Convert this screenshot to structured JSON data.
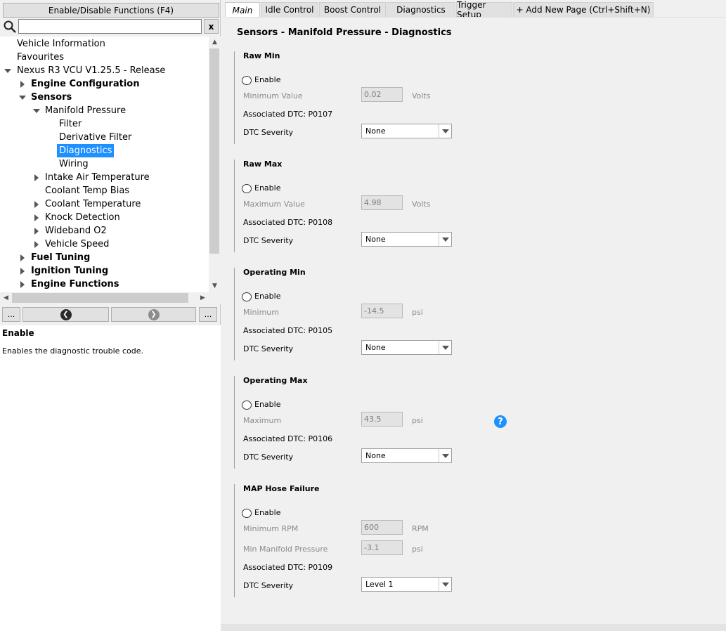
{
  "left": {
    "toggle_button": "Enable/Disable Functions (F4)",
    "search_value": "",
    "search_clear": "x",
    "tree": [
      {
        "label": "Vehicle Information",
        "bold": false,
        "level": 0,
        "arrow": "none",
        "selected": false
      },
      {
        "label": "Favourites",
        "bold": false,
        "level": 0,
        "arrow": "none",
        "selected": false
      },
      {
        "label": "Nexus R3 VCU V1.25.5 - Release",
        "bold": false,
        "level": 0,
        "arrow": "down",
        "selected": false
      },
      {
        "label": "Engine Configuration",
        "bold": true,
        "level": 1,
        "arrow": "right",
        "selected": false
      },
      {
        "label": "Sensors",
        "bold": true,
        "level": 1,
        "arrow": "down",
        "selected": false
      },
      {
        "label": "Manifold Pressure",
        "bold": false,
        "level": 2,
        "arrow": "down",
        "selected": false
      },
      {
        "label": "Filter",
        "bold": false,
        "level": 3,
        "arrow": "none",
        "selected": false
      },
      {
        "label": "Derivative Filter",
        "bold": false,
        "level": 3,
        "arrow": "none",
        "selected": false
      },
      {
        "label": "Diagnostics",
        "bold": false,
        "level": 3,
        "arrow": "none",
        "selected": true
      },
      {
        "label": "Wiring",
        "bold": false,
        "level": 3,
        "arrow": "none",
        "selected": false
      },
      {
        "label": "Intake Air Temperature",
        "bold": false,
        "level": 2,
        "arrow": "right",
        "selected": false
      },
      {
        "label": "Coolant Temp Bias",
        "bold": false,
        "level": 2,
        "arrow": "none",
        "selected": false
      },
      {
        "label": "Coolant Temperature",
        "bold": false,
        "level": 2,
        "arrow": "right",
        "selected": false
      },
      {
        "label": "Knock Detection",
        "bold": false,
        "level": 2,
        "arrow": "right",
        "selected": false
      },
      {
        "label": "Wideband O2",
        "bold": false,
        "level": 2,
        "arrow": "right",
        "selected": false
      },
      {
        "label": "Vehicle Speed",
        "bold": false,
        "level": 2,
        "arrow": "right",
        "selected": false
      },
      {
        "label": "Fuel Tuning",
        "bold": true,
        "level": 1,
        "arrow": "right",
        "selected": false
      },
      {
        "label": "Ignition Tuning",
        "bold": true,
        "level": 1,
        "arrow": "right",
        "selected": false
      },
      {
        "label": "Engine Functions",
        "bold": true,
        "level": 1,
        "arrow": "right",
        "selected": false
      }
    ],
    "nav": {
      "more_left": "...",
      "more_right": "..."
    },
    "help": {
      "title": "Enable",
      "text": "Enables the diagnostic trouble code."
    }
  },
  "tabs": [
    {
      "label": "Main",
      "active": true
    },
    {
      "label": "Idle Control",
      "active": false
    },
    {
      "label": "Boost Control",
      "active": false
    },
    {
      "label": "Diagnostics",
      "active": false
    },
    {
      "label": "Trigger Setup",
      "active": false
    },
    {
      "label": "+ Add New Page (Ctrl+Shift+N)",
      "active": false
    }
  ],
  "page": {
    "title": "Sensors - Manifold Pressure - Diagnostics",
    "enable_label": "Enable",
    "sections": [
      {
        "title": "Raw Min",
        "fields": [
          {
            "label": "Minimum Value",
            "value": "0.02",
            "unit": "Volts"
          }
        ],
        "dtc": "Associated DTC: P0107",
        "severity_label": "DTC Severity",
        "severity": "None"
      },
      {
        "title": "Raw Max",
        "fields": [
          {
            "label": "Maximum Value",
            "value": "4.98",
            "unit": "Volts"
          }
        ],
        "dtc": "Associated DTC: P0108",
        "severity_label": "DTC Severity",
        "severity": "None"
      },
      {
        "title": "Operating Min",
        "fields": [
          {
            "label": "Minimum",
            "value": "-14.5",
            "unit": "psi"
          }
        ],
        "dtc": "Associated DTC: P0105",
        "severity_label": "DTC Severity",
        "severity": "None"
      },
      {
        "title": "Operating Max",
        "fields": [
          {
            "label": "Maximum",
            "value": "43.5",
            "unit": "psi"
          }
        ],
        "dtc": "Associated DTC: P0106",
        "severity_label": "DTC Severity",
        "severity": "None"
      },
      {
        "title": "MAP Hose Failure",
        "fields": [
          {
            "label": "Minimum RPM",
            "value": "600",
            "unit": "RPM"
          },
          {
            "label": "Min Manifold Pressure",
            "value": "-3.1",
            "unit": "psi"
          }
        ],
        "dtc": "Associated DTC: P0109",
        "severity_label": "DTC Severity",
        "severity": "Level 1"
      }
    ],
    "help_icon_glyph": "?"
  },
  "colors": {
    "selection": "#1e90ff",
    "help_icon": "#1e90ff",
    "nav_arrow": "#2b2b2b"
  }
}
